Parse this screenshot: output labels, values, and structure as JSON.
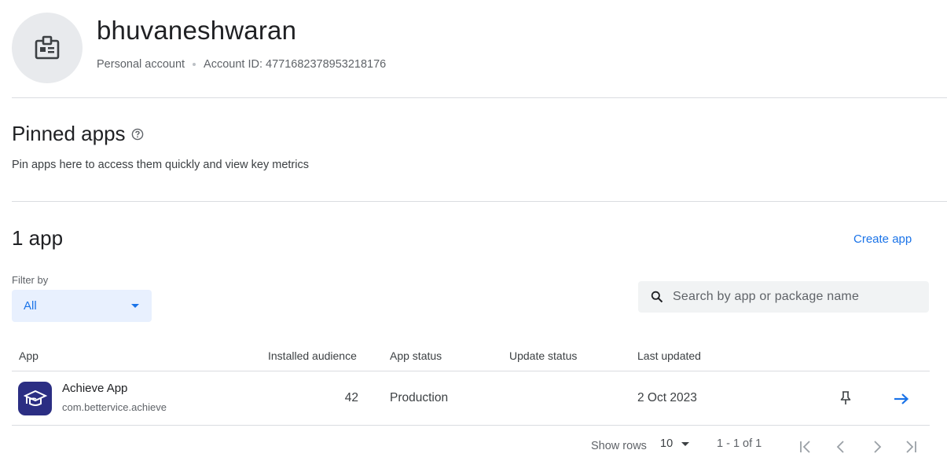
{
  "account": {
    "name": "bhuvaneshwaran",
    "type": "Personal account",
    "id_label": "Account ID: 4771682378953218176",
    "avatar_icon": "id-badge-icon"
  },
  "pinned": {
    "title": "Pinned apps",
    "subtitle": "Pin apps here to access them quickly and view key metrics"
  },
  "apps_section": {
    "count_label": "1 app",
    "create_label": "Create app"
  },
  "filter": {
    "label": "Filter by",
    "selected": "All"
  },
  "search": {
    "placeholder": "Search by app or package name"
  },
  "table": {
    "columns": [
      "App",
      "Installed audience",
      "App status",
      "Update status",
      "Last updated"
    ],
    "rows": [
      {
        "app_name": "Achieve App",
        "package": "com.bettervice.achieve",
        "installed_audience": "42",
        "app_status": "Production",
        "update_status": "",
        "last_updated": "2 Oct 2023",
        "icon": "graduation-cap-icon"
      }
    ]
  },
  "pagination": {
    "show_rows_label": "Show rows",
    "rows_per_page": "10",
    "range": "1 - 1 of 1"
  },
  "colors": {
    "accent": "#1a73e8",
    "app_icon_bg": "#2b2e83"
  }
}
